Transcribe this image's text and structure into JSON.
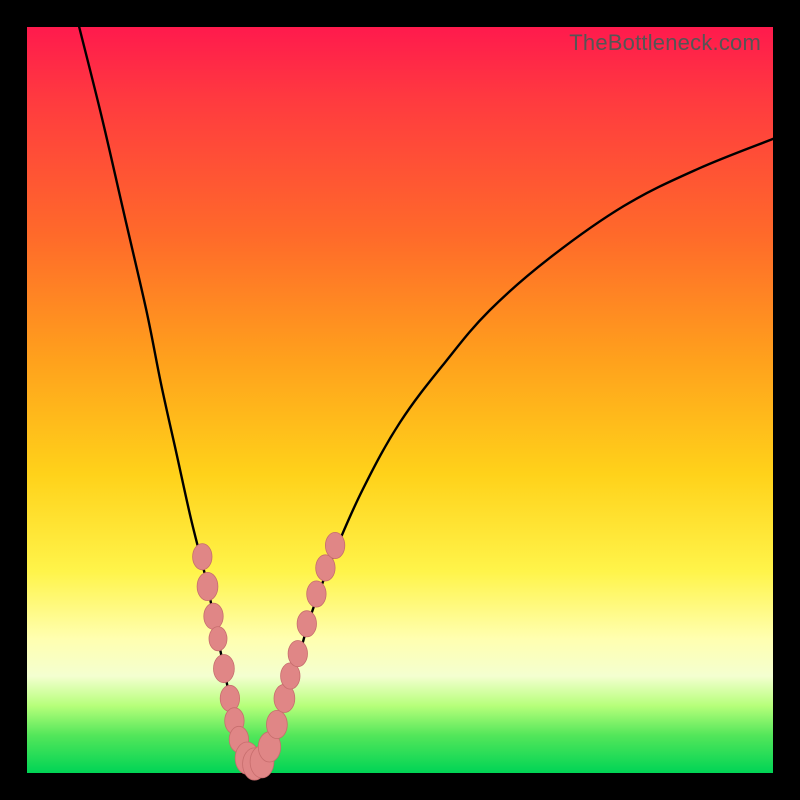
{
  "watermark": "TheBottleneck.com",
  "colors": {
    "curve": "#000000",
    "marker_fill": "#e08686",
    "marker_stroke": "#c76d6d",
    "frame": "#000000"
  },
  "chart_data": {
    "type": "line",
    "title": "",
    "xlabel": "",
    "ylabel": "",
    "xlim": [
      0,
      100
    ],
    "ylim": [
      0,
      100
    ],
    "series": [
      {
        "name": "bottleneck-curve",
        "x": [
          7,
          10,
          13,
          16,
          18,
          20,
          22,
          24,
          25,
          26,
          27,
          28,
          29,
          30,
          31,
          32,
          34,
          36,
          38,
          41,
          45,
          50,
          56,
          62,
          70,
          80,
          90,
          100
        ],
        "y": [
          100,
          88,
          75,
          62,
          52,
          43,
          34,
          26,
          21,
          16,
          11,
          6,
          3,
          1,
          1,
          3,
          8,
          14,
          21,
          29,
          38,
          47,
          55,
          62,
          69,
          76,
          81,
          85
        ]
      }
    ],
    "markers": [
      {
        "x": 23.5,
        "y": 29,
        "r": 1.3
      },
      {
        "x": 24.2,
        "y": 25,
        "r": 1.4
      },
      {
        "x": 25.0,
        "y": 21,
        "r": 1.3
      },
      {
        "x": 25.6,
        "y": 18,
        "r": 1.2
      },
      {
        "x": 26.4,
        "y": 14,
        "r": 1.4
      },
      {
        "x": 27.2,
        "y": 10,
        "r": 1.3
      },
      {
        "x": 27.8,
        "y": 7,
        "r": 1.3
      },
      {
        "x": 28.4,
        "y": 4.5,
        "r": 1.3
      },
      {
        "x": 29.5,
        "y": 2,
        "r": 1.6
      },
      {
        "x": 30.5,
        "y": 1.2,
        "r": 1.6
      },
      {
        "x": 31.5,
        "y": 1.5,
        "r": 1.6
      },
      {
        "x": 32.5,
        "y": 3.5,
        "r": 1.5
      },
      {
        "x": 33.5,
        "y": 6.5,
        "r": 1.4
      },
      {
        "x": 34.5,
        "y": 10,
        "r": 1.4
      },
      {
        "x": 35.3,
        "y": 13,
        "r": 1.3
      },
      {
        "x": 36.3,
        "y": 16,
        "r": 1.3
      },
      {
        "x": 37.5,
        "y": 20,
        "r": 1.3
      },
      {
        "x": 38.8,
        "y": 24,
        "r": 1.3
      },
      {
        "x": 40.0,
        "y": 27.5,
        "r": 1.3
      },
      {
        "x": 41.3,
        "y": 30.5,
        "r": 1.3
      }
    ]
  }
}
